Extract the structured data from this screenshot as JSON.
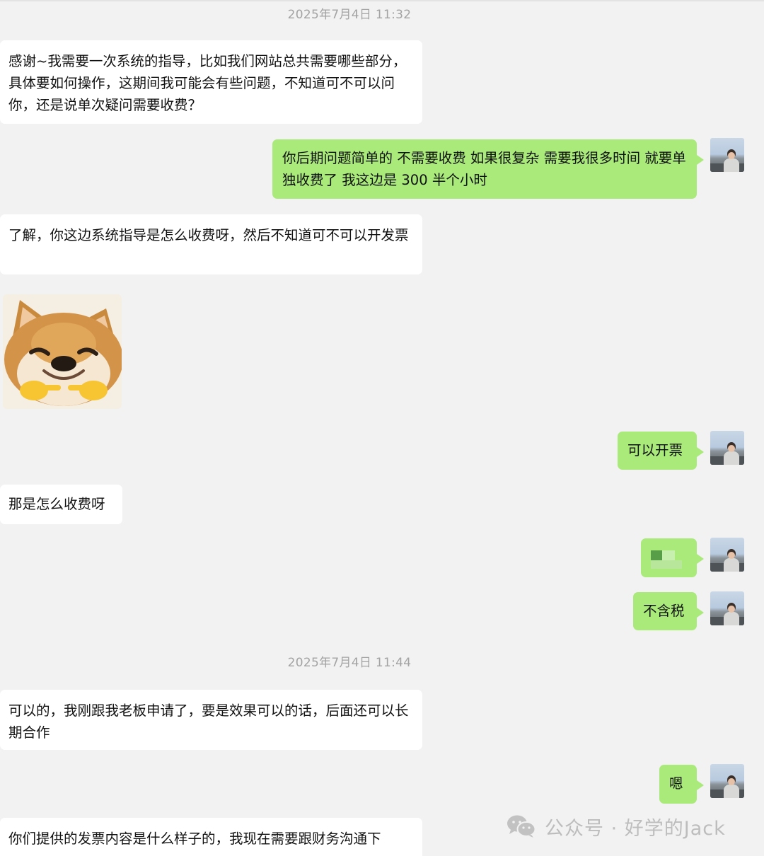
{
  "timestamps": [
    "2025年7月4日 11:32",
    "2025年7月4日 11:44"
  ],
  "messages": {
    "m1": "感谢~我需要一次系统的指导，比如我们网站总共需要哪些部分，具体要如何操作，这期间我可能会有些问题，不知道可不可以问你，还是说单次疑问需要收费？",
    "m2": "你后期问题简单的 不需要收费 如果很复杂 需要我很多时间 就要单独收费了 我这边是 300 半个小时",
    "m3": "了解，你这边系统指导是怎么收费呀，然后不知道可不可以开发票",
    "m5": "可以开票",
    "m6": "那是怎么收费呀",
    "m8": "不含税",
    "m9": "可以的，我刚跟我老板申请了，要是效果可以的话，后面还可以长期合作",
    "m10": "嗯",
    "m11": "你们提供的发票内容是什么样子的，我现在需要跟财务沟通下"
  },
  "watermark": {
    "text": "公众号 · 好学的Jack",
    "icon": "wechat-icon"
  },
  "colors": {
    "background": "#f2f2f2",
    "incoming_bubble": "#ffffff",
    "outgoing_bubble": "#a9ea7a",
    "timestamp": "#a3a3a3"
  }
}
